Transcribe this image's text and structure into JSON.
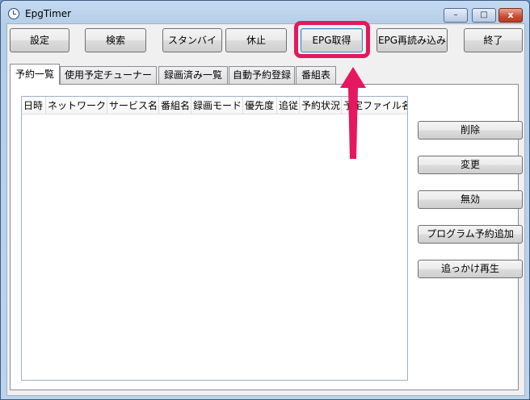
{
  "window": {
    "title": "EpgTimer"
  },
  "titlebar": {
    "minimize": "–",
    "maximize": "□",
    "close": "x"
  },
  "toolbar": {
    "settings": "設定",
    "search": "検索",
    "standby": "スタンバイ",
    "pause": "休止",
    "epg_fetch": "EPG取得",
    "epg_reload": "EPG再読み込み",
    "exit": "終了"
  },
  "tabs": [
    "予約一覧",
    "使用予定チューナー",
    "録画済み一覧",
    "自動予約登録",
    "番組表"
  ],
  "reserve_list": {
    "columns": [
      "日時",
      "ネットワーク",
      "サービス名",
      "番組名",
      "録画モード",
      "優先度",
      "追従",
      "予約状況",
      "予定ファイル名"
    ]
  },
  "side_buttons": {
    "delete": "削除",
    "change": "変更",
    "disable": "無効",
    "add_program": "プログラム予約追加",
    "chase_play": "追っかけ再生"
  },
  "annotation": {
    "color": "#e5175e"
  }
}
